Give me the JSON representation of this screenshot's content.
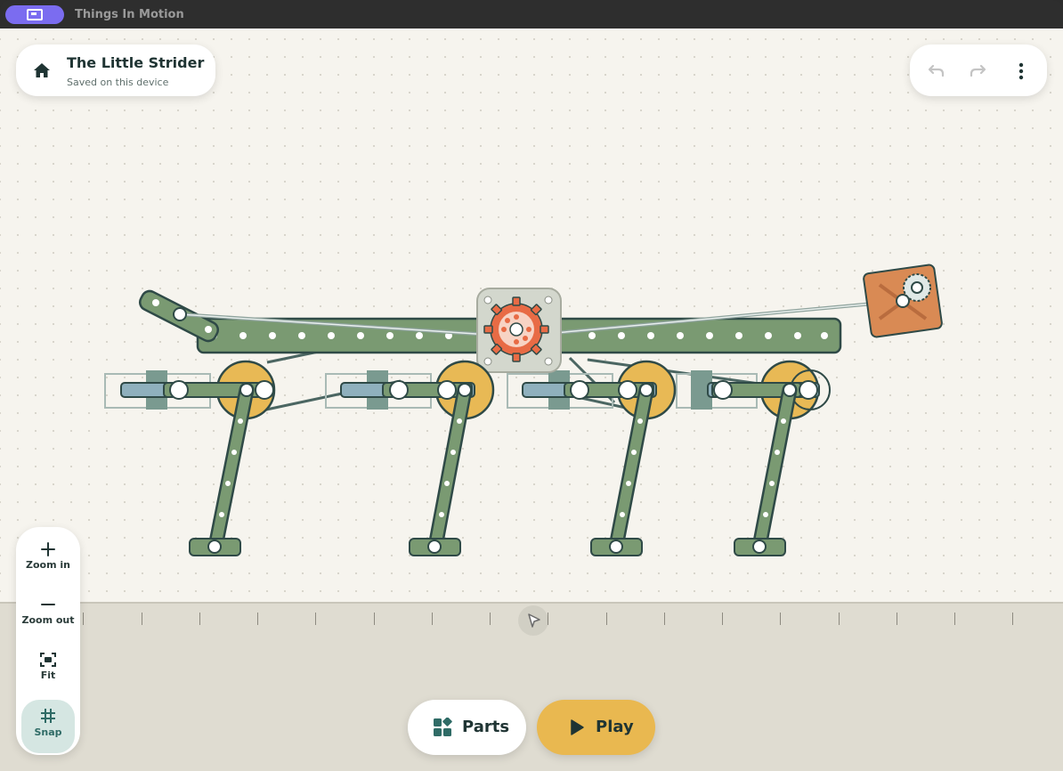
{
  "window": {
    "title": "Things In Motion",
    "app_icon": "screen-share-icon"
  },
  "header": {
    "home_icon": "home-icon",
    "title": "The Little Strider",
    "subtitle": "Saved on this device"
  },
  "history": {
    "undo_icon": "undo-icon",
    "redo_icon": "redo-icon",
    "more_icon": "more-vertical-icon"
  },
  "zoom_panel": {
    "zoom_in": "Zoom in",
    "zoom_out": "Zoom out",
    "fit": "Fit",
    "snap": "Snap",
    "snap_active": true
  },
  "bottom_bar": {
    "parts_label": "Parts",
    "play_label": "Play"
  },
  "colors": {
    "canvas": "#f6f4ee",
    "ground": "#dfdcd1",
    "beam_green": "#7a9a72",
    "outline": "#2f4a47",
    "wheel_gold": "#e8b955",
    "gear_orange": "#e86b45",
    "crate": "#d98a54",
    "play_button": "#e9b850",
    "brand_purple": "#7b6cf0"
  }
}
